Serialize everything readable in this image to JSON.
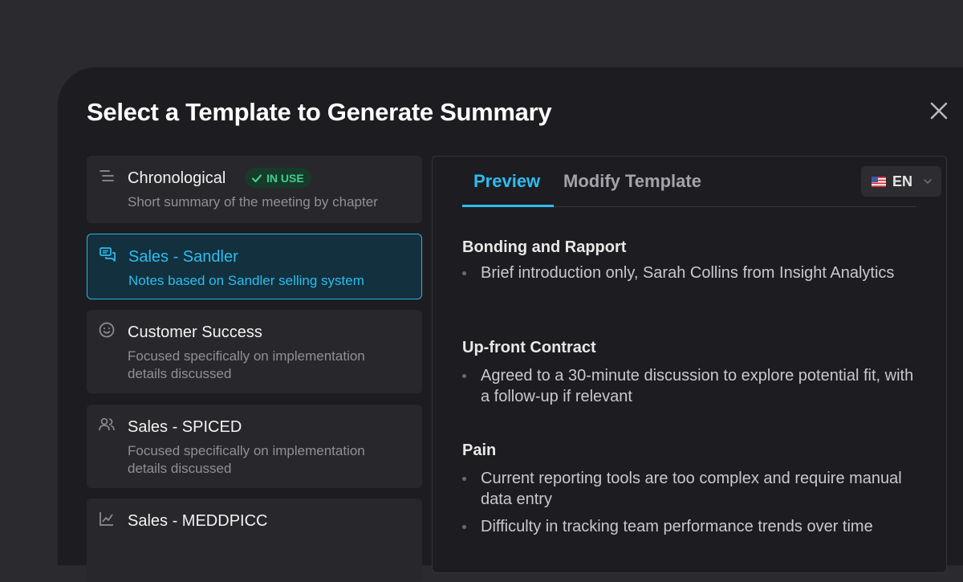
{
  "modal": {
    "title": "Select a Template to Generate Summary",
    "close_icon": "close-icon"
  },
  "templates": [
    {
      "name": "Chronological",
      "icon": "list-icon",
      "badge": "IN USE",
      "description": "Short summary of the meeting by chapter",
      "active": false
    },
    {
      "name": "Sales - Sandler",
      "icon": "chat-bubbles-icon",
      "description": "Notes based on Sandler selling system",
      "active": true
    },
    {
      "name": "Customer Success",
      "icon": "smiley-icon",
      "description": "Focused specifically on implementation details discussed",
      "active": false
    },
    {
      "name": "Sales - SPICED",
      "icon": "users-icon",
      "description": "Focused specifically on implementation details discussed",
      "active": false
    },
    {
      "name": "Sales - MEDDPICC",
      "icon": "chart-line-icon",
      "description": "",
      "active": false
    }
  ],
  "preview": {
    "tabs": [
      {
        "label": "Preview",
        "active": true
      },
      {
        "label": "Modify Template",
        "active": false
      }
    ],
    "language": {
      "code": "EN",
      "flag": "us-flag-icon"
    },
    "sections": [
      {
        "title": "Bonding and Rapport",
        "bullets": [
          "Brief introduction only, Sarah Collins from Insight Analytics"
        ]
      },
      {
        "title": "Up-front Contract",
        "bullets": [
          "Agreed to a 30-minute discussion to explore potential fit, with a follow-up if relevant"
        ]
      },
      {
        "title": "Pain",
        "bullets": [
          "Current reporting tools are too complex and require manual data entry",
          "Difficulty in tracking team performance trends over time"
        ]
      }
    ]
  },
  "colors": {
    "accent": "#2cbdf0",
    "badge_green": "#3fd08a",
    "background": "#1d1d21"
  }
}
